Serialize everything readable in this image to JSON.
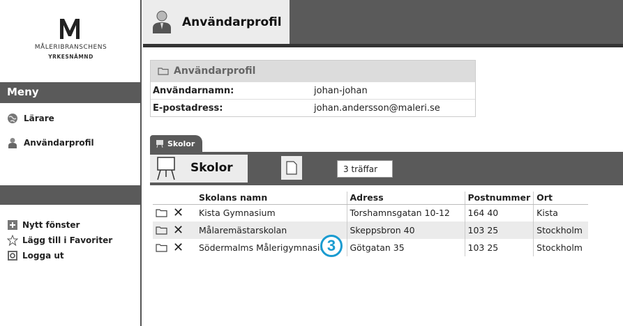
{
  "logo": {
    "line1": "MÅLERIBRANSCHENS",
    "line2": "YRKESNÄMND"
  },
  "sidebar": {
    "menu_header": "Meny",
    "items": [
      {
        "label": "Lärare",
        "icon": "globe-icon"
      },
      {
        "label": "Användarprofil",
        "icon": "user-icon"
      }
    ],
    "tools": [
      {
        "label": "Nytt fönster",
        "icon": "new-window-icon"
      },
      {
        "label": "Lägg till i Favoriter",
        "icon": "star-icon"
      },
      {
        "label": "Logga ut",
        "icon": "logout-icon"
      }
    ]
  },
  "header": {
    "title": "Användarprofil"
  },
  "profile": {
    "title": "Användarprofil",
    "rows": [
      {
        "label": "Användarnamn:",
        "value": "johan-johan"
      },
      {
        "label": "E-postadress:",
        "value": "johan.andersson@maleri.se"
      }
    ]
  },
  "schools": {
    "tab_label": "Skolor",
    "title": "Skolor",
    "hits": "3 träffar",
    "columns": [
      "Skolans namn",
      "Adress",
      "Postnummer",
      "Ort"
    ],
    "rows": [
      {
        "name": "Kista Gymnasium",
        "address": "Torshamnsgatan 10-12",
        "zip": "164 40",
        "city": "Kista"
      },
      {
        "name": "Målaremästarskolan",
        "address": "Skeppsbron 40",
        "zip": "103 25",
        "city": "Stockholm"
      },
      {
        "name": "Södermalms Målerigymnasium",
        "address": "Götgatan 35",
        "zip": "103 25",
        "city": "Stockholm"
      }
    ]
  },
  "annotation": {
    "number": "3"
  },
  "colors": {
    "dark_bar": "#5a5a5a",
    "light_panel": "#ececec",
    "badge": "#1a9bd0"
  }
}
